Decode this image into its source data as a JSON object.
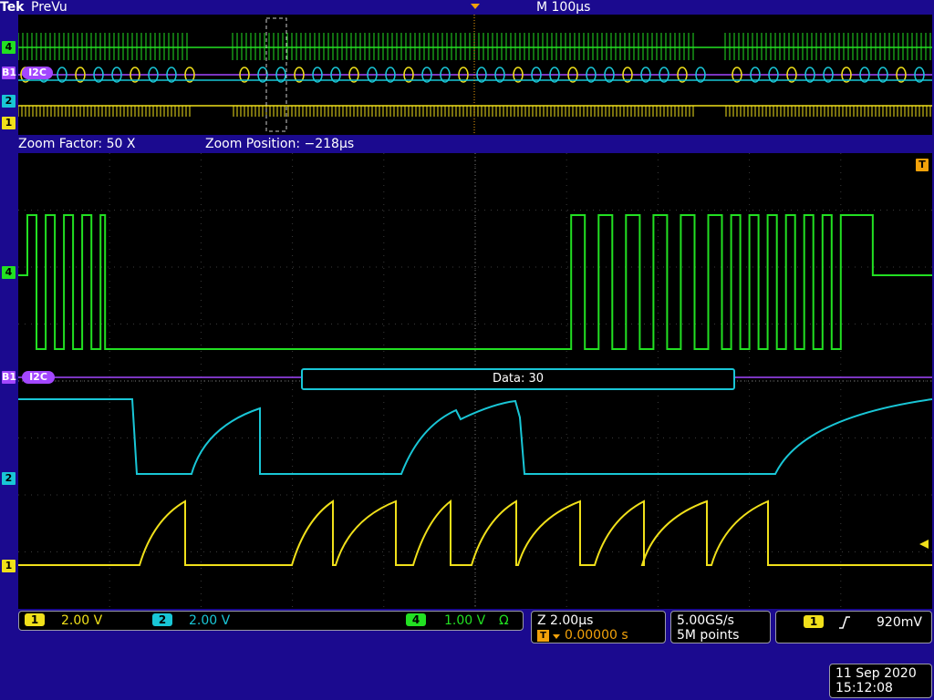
{
  "header": {
    "brand": "Tek",
    "mode": "PreVu",
    "timebase": "M 100µs"
  },
  "zoom_info": {
    "factor": "Zoom Factor: 50 X",
    "position": "Zoom Position: −218µs"
  },
  "channels": [
    {
      "id": "4",
      "color": "#22e022"
    },
    {
      "id": "B1",
      "color": "#a347ff",
      "bus": "I2C"
    },
    {
      "id": "2",
      "color": "#19c6d6"
    },
    {
      "id": "1",
      "color": "#f0e01a"
    }
  ],
  "trigger_marker": "T",
  "decode_box": {
    "text": "Data: 30"
  },
  "status_bar": {
    "ch1": {
      "id": "1",
      "scale": "2.00 V"
    },
    "ch2": {
      "id": "2",
      "scale": "2.00 V"
    },
    "ch4": {
      "id": "4",
      "scale": "1.00 V",
      "termination": "Ω"
    },
    "zoom": {
      "scale": "Z 2.00µs",
      "trigger_pos": "0.00000 s"
    },
    "acq": {
      "rate": "5.00GS/s",
      "record": "5M points"
    },
    "trigger": {
      "source": "1",
      "slope": "rising-edge-icon",
      "level": "920mV"
    }
  },
  "datetime": {
    "date": "11 Sep  2020",
    "time": "15:12:08"
  },
  "chart_data": {
    "type": "line",
    "x_range_us": [
      -10,
      10
    ],
    "grid": true,
    "series": [
      {
        "name": "4",
        "edges_us": [
          -9.8,
          -9.6,
          -9.4,
          -9.2,
          -9.0,
          -8.8,
          -8.6,
          -8.4,
          -8.2,
          -8.1,
          2.1,
          2.4,
          2.7,
          3.0,
          3.3,
          3.6,
          3.9,
          4.2,
          4.5,
          4.8,
          5.1,
          5.4,
          5.6,
          5.8,
          6.0,
          6.2,
          6.4,
          6.6,
          6.8,
          7.0,
          7.2,
          7.4,
          7.6,
          7.8,
          8.0
        ]
      },
      {
        "name": "2",
        "levels": "high-low-high steps"
      },
      {
        "name": "1",
        "levels": "low with rising pulses"
      }
    ]
  }
}
